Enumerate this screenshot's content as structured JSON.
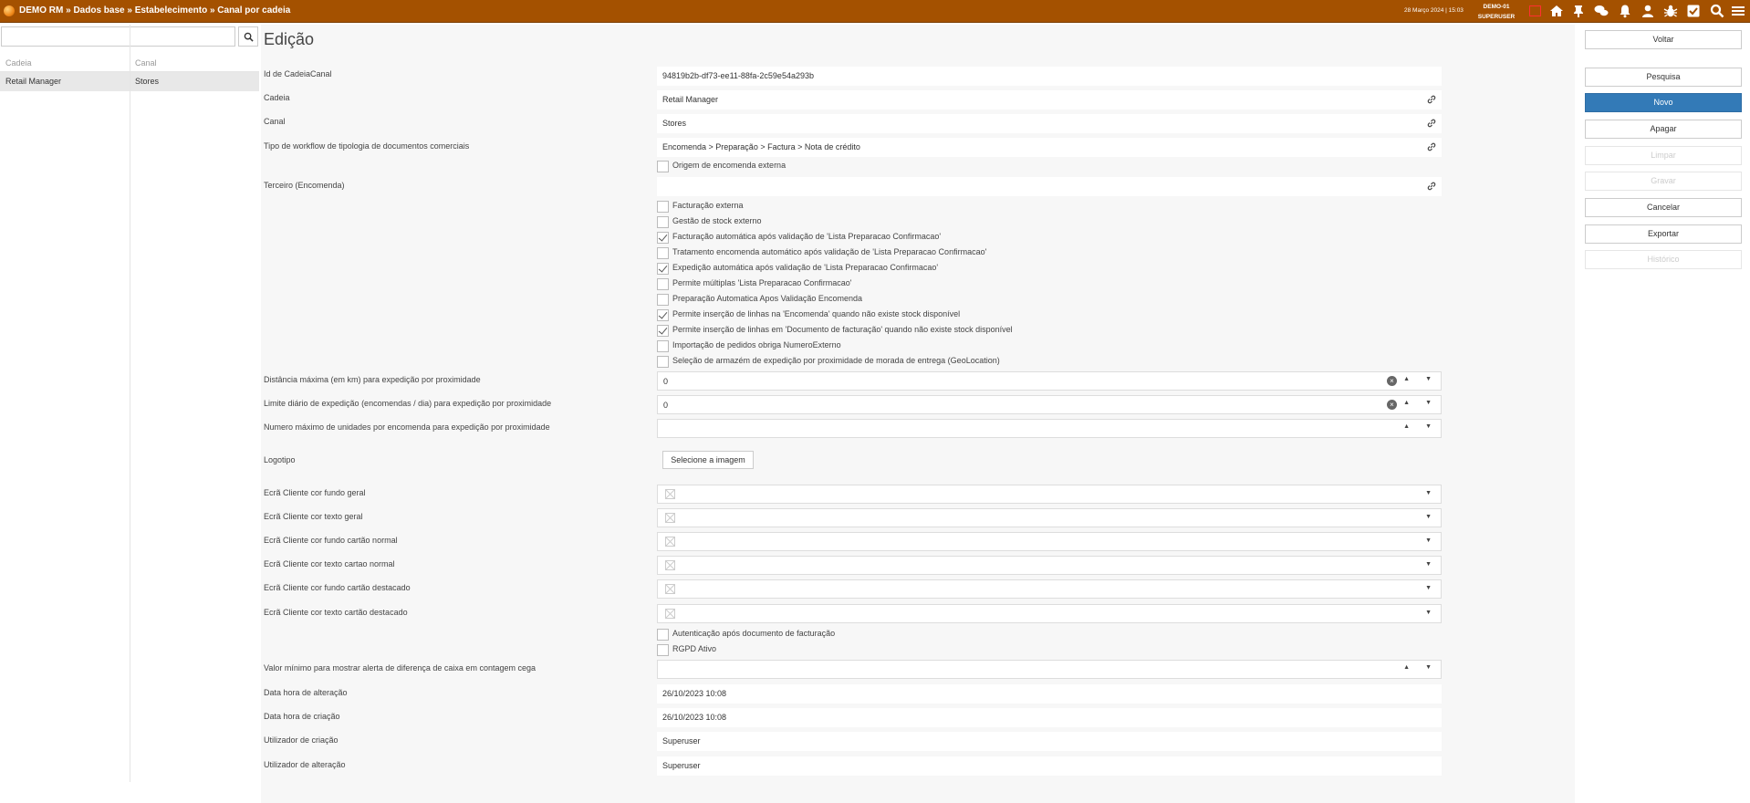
{
  "header": {
    "breadcrumb": "DEMO RM » Dados base » Estabelecimento » Canal por cadeia",
    "datetime": "28 Março 2024 | 15:03",
    "user_db": "DEMO-01",
    "user_name": "SUPERUSER"
  },
  "left_panel": {
    "search_value": "",
    "columns": [
      "Cadeia",
      "Canal"
    ],
    "rows": [
      {
        "cadeia": "Retail Manager",
        "canal": "Stores"
      }
    ]
  },
  "form": {
    "title": "Edição",
    "fields": {
      "id": {
        "label": "Id de CadeiaCanal",
        "value": "94819b2b-df73-ee11-88fa-2c59e54a293b"
      },
      "cadeia": {
        "label": "Cadeia",
        "value": "Retail Manager"
      },
      "canal": {
        "label": "Canal",
        "value": "Stores"
      },
      "workflow": {
        "label": "Tipo de workflow de tipologia de documentos comerciais",
        "value": "Encomenda > Preparação > Factura > Nota de crédito"
      },
      "terceiro": {
        "label": "Terceiro (Encomenda)",
        "value": ""
      },
      "dist_max": {
        "label": "Distância máxima (em km) para expedição por proximidade",
        "value": "0"
      },
      "limite_diario": {
        "label": "Limite diário de expedição (encomendas / dia) para expedição por proximidade",
        "value": "0"
      },
      "num_max_unid": {
        "label": "Numero máximo de unidades por encomenda para expedição por proximidade",
        "value": ""
      },
      "logotipo": {
        "label": "Logotipo",
        "button": "Selecione a imagem"
      },
      "cor_fundo_geral": {
        "label": "Ecrã Cliente cor fundo geral"
      },
      "cor_texto_geral": {
        "label": "Ecrã Cliente cor texto geral"
      },
      "cor_fundo_normal": {
        "label": "Ecrã Cliente cor fundo cartão normal"
      },
      "cor_texto_normal": {
        "label": "Ecrã Cliente cor texto cartao normal"
      },
      "cor_fundo_destacado": {
        "label": "Ecrã Cliente cor fundo cartão destacado"
      },
      "cor_texto_destacado": {
        "label": "Ecrã Cliente cor texto cartão destacado"
      },
      "valor_minimo": {
        "label": "Valor mínimo para mostrar alerta de diferença de caixa em contagem cega",
        "value": ""
      },
      "data_alteracao": {
        "label": "Data hora de alteração",
        "value": "26/10/2023 10:08"
      },
      "data_criacao": {
        "label": "Data hora de criação",
        "value": "26/10/2023 10:08"
      },
      "util_criacao": {
        "label": "Utilizador de criação",
        "value": "Superuser"
      },
      "util_alteracao": {
        "label": "Utilizador de alteração",
        "value": "Superuser"
      }
    },
    "checkbox_origem": {
      "label": "Origem de encomenda externa",
      "checked": false
    },
    "checkboxes": [
      {
        "label": "Facturação externa",
        "checked": false
      },
      {
        "label": "Gestão de stock externo",
        "checked": false
      },
      {
        "label": "Facturação automática após validação de 'Lista Preparacao Confirmacao'",
        "checked": true
      },
      {
        "label": "Tratamento encomenda automático após validação de 'Lista Preparacao Confirmacao'",
        "checked": false
      },
      {
        "label": "Expedição automática após validação de 'Lista Preparacao Confirmacao'",
        "checked": true
      },
      {
        "label": "Permite múltiplas 'Lista Preparacao Confirmacao'",
        "checked": false
      },
      {
        "label": "Preparação Automatica Apos Validação Encomenda",
        "checked": false
      },
      {
        "label": "Permite inserção de linhas na 'Encomenda' quando não existe stock disponível",
        "checked": true
      },
      {
        "label": "Permite inserção de linhas em 'Documento de facturação' quando não existe stock disponível",
        "checked": true
      },
      {
        "label": "Importação de pedidos obriga NumeroExterno",
        "checked": false
      },
      {
        "label": "Seleção de armazém de expedição por proximidade de morada de entrega (GeoLocation)",
        "checked": false
      }
    ],
    "checkboxes_bottom": [
      {
        "label": "Autenticação após documento de facturação",
        "checked": false
      },
      {
        "label": "RGPD Ativo",
        "checked": false
      }
    ]
  },
  "actions": {
    "voltar": "Voltar",
    "pesquisa": "Pesquisa",
    "novo": "Novo",
    "apagar": "Apagar",
    "limpar": "Limpar",
    "gravar": "Gravar",
    "cancelar": "Cancelar",
    "exportar": "Exportar",
    "historico": "Histórico"
  },
  "icons": [
    "orange-ball-logo-icon",
    "notification-red-square-icon",
    "home-icon",
    "pin-icon",
    "chat-icon",
    "bell-icon",
    "user-icon",
    "bug-icon",
    "check-square-icon",
    "search-icon",
    "menu-icon"
  ],
  "colors": {
    "topbar": "#a45100",
    "primary": "#337ab7"
  }
}
